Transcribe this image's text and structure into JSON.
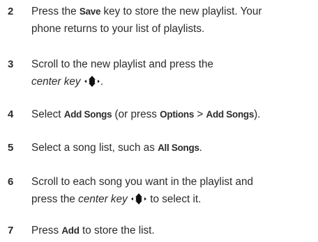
{
  "steps": [
    {
      "num": "2",
      "p1": "Press the ",
      "key1": "Save",
      "p2": " key to store the new playlist. Your",
      "line2": "phone returns to your list of playlists."
    },
    {
      "num": "3",
      "line1": "Scroll to the new playlist and press the",
      "italic": "center key",
      "tail": "."
    },
    {
      "num": "4",
      "p1": "Select ",
      "key1": "Add Songs",
      "p2": " (or press ",
      "key2": "Options",
      "p3": " > ",
      "key3": "Add Songs",
      "p4": ")."
    },
    {
      "num": "5",
      "p1": "Select a song list, such as ",
      "key1": "All Songs",
      "p2": "."
    },
    {
      "num": "6",
      "line1": "Scroll to each song you want in the playlist and",
      "p1": "press the ",
      "italic": "center key",
      "p2": " to select it."
    },
    {
      "num": "7",
      "p1": "Press ",
      "key1": "Add",
      "p2": " to store the list."
    }
  ],
  "icons": {
    "center_key": "nav-center-key-icon"
  },
  "colors": {
    "text": "#2b2b2b",
    "background": "#ffffff"
  }
}
